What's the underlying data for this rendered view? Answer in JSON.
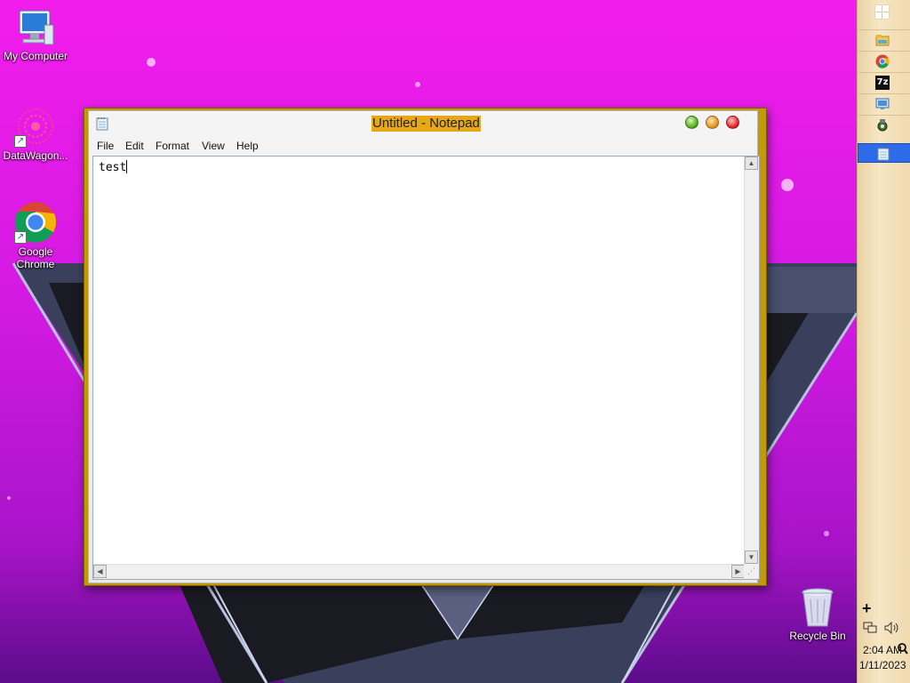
{
  "desktop": {
    "icons": [
      {
        "label": "My Computer"
      },
      {
        "label": "DataWagon..."
      },
      {
        "label": "Google Chrome"
      },
      {
        "label": "Recycle Bin"
      }
    ]
  },
  "notepad": {
    "title": "Untitled - Notepad",
    "menu": [
      "File",
      "Edit",
      "Format",
      "View",
      "Help"
    ],
    "content": "test"
  },
  "taskbar": {
    "items": [
      "file-explorer",
      "chrome",
      "7zip",
      "remote-desktop",
      "settings-tool",
      "notepad"
    ],
    "active": "notepad",
    "sevenzip_label": "7z",
    "tray_plus": "+",
    "time": "2:04 AM",
    "date": "1/11/2023"
  },
  "colors": {
    "accent_titlebar": "#c39a06",
    "title_highlight": "#e6a817",
    "taskbar_active": "#2e6bea"
  }
}
